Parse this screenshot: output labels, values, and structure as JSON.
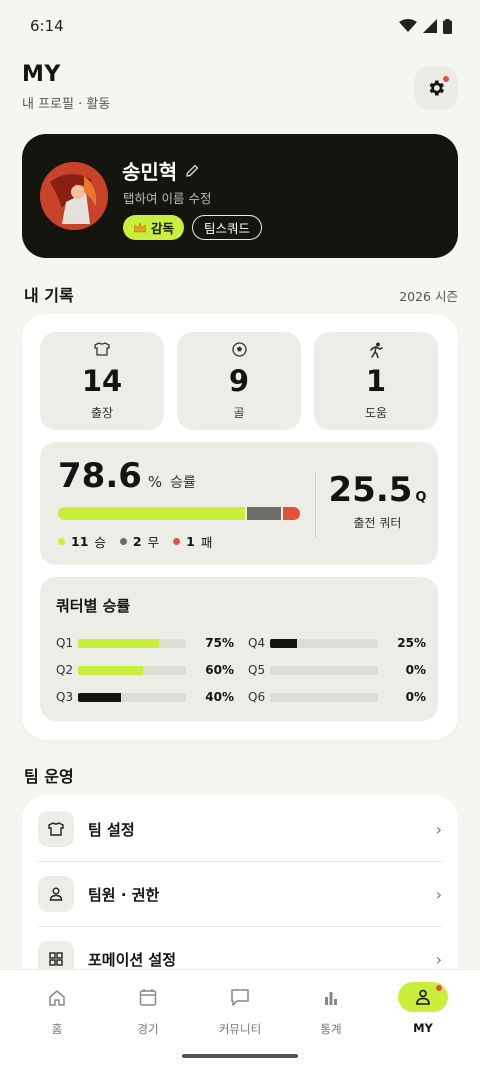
{
  "status_bar": {
    "time": "6:14"
  },
  "header": {
    "title": "MY",
    "subtitle": "내 프로필 · 활동"
  },
  "profile": {
    "name": "송민혁",
    "edit_hint": "탭하여 이름 수정",
    "role_badge": "감독",
    "team_badge": "팀스쿼드"
  },
  "records": {
    "title": "내 기록",
    "season": "2026 시즌",
    "stats": [
      {
        "value": "14",
        "label": "출장",
        "icon": "jersey-icon"
      },
      {
        "value": "9",
        "label": "골",
        "icon": "soccer-ball-icon"
      },
      {
        "value": "1",
        "label": "도움",
        "icon": "runner-icon"
      }
    ],
    "win_rate": {
      "value": "78.6",
      "unit": "%",
      "label": "승률"
    },
    "wdl": [
      {
        "count": "11",
        "label": "승",
        "color": "#c9ef3c",
        "ratio": 11
      },
      {
        "count": "2",
        "label": "무",
        "color": "#6e6e68",
        "ratio": 2
      },
      {
        "count": "1",
        "label": "패",
        "color": "#e2523a",
        "ratio": 1
      }
    ],
    "quarters": {
      "value": "25.5",
      "unit": "Q",
      "label": "출전 쿼터"
    },
    "quarter_win": {
      "title": "쿼터별 승률",
      "rows": [
        {
          "label": "Q1",
          "pct_text": "75%",
          "pct": 75,
          "color": "#c9ef3c"
        },
        {
          "label": "Q2",
          "pct_text": "60%",
          "pct": 60,
          "color": "#c9ef3c"
        },
        {
          "label": "Q3",
          "pct_text": "40%",
          "pct": 40,
          "color": "#151510"
        },
        {
          "label": "Q4",
          "pct_text": "25%",
          "pct": 25,
          "color": "#151510"
        },
        {
          "label": "Q5",
          "pct_text": "0%",
          "pct": 0,
          "color": "#151510"
        },
        {
          "label": "Q6",
          "pct_text": "0%",
          "pct": 0,
          "color": "#151510"
        }
      ]
    }
  },
  "team": {
    "title": "팀 운영",
    "items": [
      {
        "label": "팀 설정",
        "icon": "jersey-icon"
      },
      {
        "label": "팀원 · 권한",
        "icon": "person-icon"
      },
      {
        "label": "포메이션 설정",
        "icon": "grid-icon"
      }
    ]
  },
  "nav": [
    {
      "label": "홈",
      "icon": "home-icon"
    },
    {
      "label": "경기",
      "icon": "calendar-icon"
    },
    {
      "label": "커뮤니티",
      "icon": "chat-icon"
    },
    {
      "label": "통계",
      "icon": "bar-chart-icon"
    },
    {
      "label": "MY",
      "icon": "person-icon",
      "active": true
    }
  ]
}
